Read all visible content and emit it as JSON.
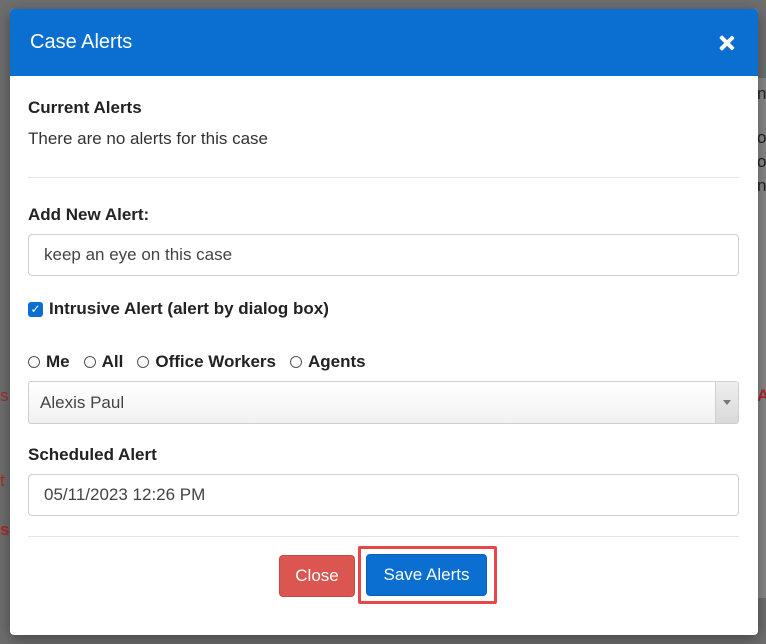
{
  "modal": {
    "title": "Case Alerts",
    "current_alerts": {
      "heading": "Current Alerts",
      "text": "There are no alerts for this case"
    },
    "new_alert": {
      "label": "Add New Alert:",
      "value": "keep an eye on this case"
    },
    "intrusive": {
      "checked": true,
      "label": "Intrusive Alert (alert by dialog box)"
    },
    "recipients": {
      "options": [
        "Me",
        "All",
        "Office Workers",
        "Agents"
      ],
      "selected_user": "Alexis Paul"
    },
    "scheduled": {
      "label": "Scheduled Alert",
      "value": "05/11/2023 12:26 PM"
    },
    "buttons": {
      "close": "Close",
      "save": "Save Alerts"
    }
  },
  "colors": {
    "header": "#0a6fd0",
    "close_button": "#dc5651",
    "save_button": "#0a6fd0",
    "highlight": "#e8474a"
  }
}
